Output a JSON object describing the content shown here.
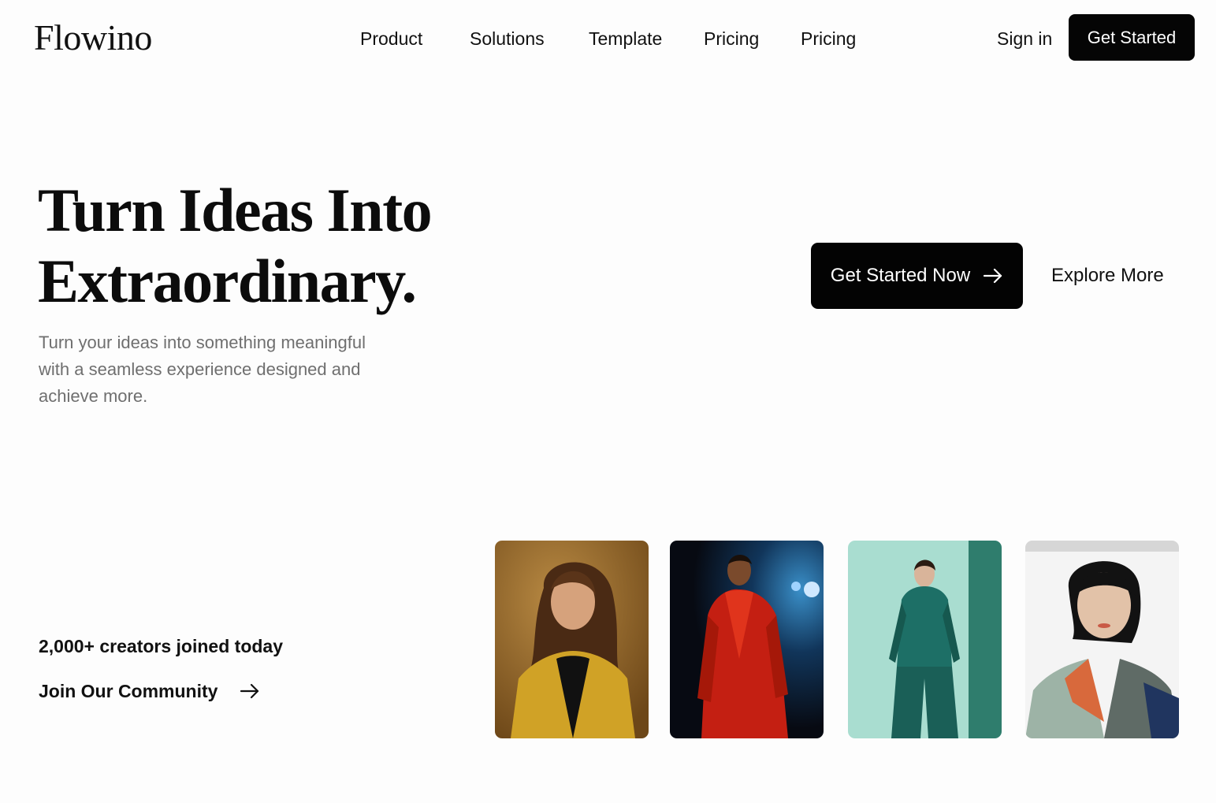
{
  "header": {
    "logo": "Flowino",
    "nav": [
      "Product",
      "Solutions",
      "Template",
      "Pricing",
      "Pricing"
    ],
    "sign_in": "Sign in",
    "cta": "Get Started"
  },
  "hero": {
    "title_line1": "Turn Ideas Into",
    "title_line2": "Extraordinary.",
    "subtitle": "Turn your ideas into something meaningful with a seamless experience designed and achieve more.",
    "primary_cta": "Get Started Now",
    "primary_cta_icon": "arrow-right-icon",
    "secondary_cta": "Explore More"
  },
  "community": {
    "creators_text": "2,000+ creators joined today",
    "join_label": "Join Our Community",
    "join_icon": "arrow-right-icon"
  },
  "gallery": {
    "photos": [
      "portrait-woman-yellow-jacket",
      "portrait-man-red-suit",
      "portrait-woman-teal-suit",
      "portrait-woman-colorblock-blazer"
    ]
  },
  "colors": {
    "background": "#fdfdfd",
    "primary_button": "#050505",
    "text": "#111111",
    "muted_text": "#6f6f6f"
  }
}
